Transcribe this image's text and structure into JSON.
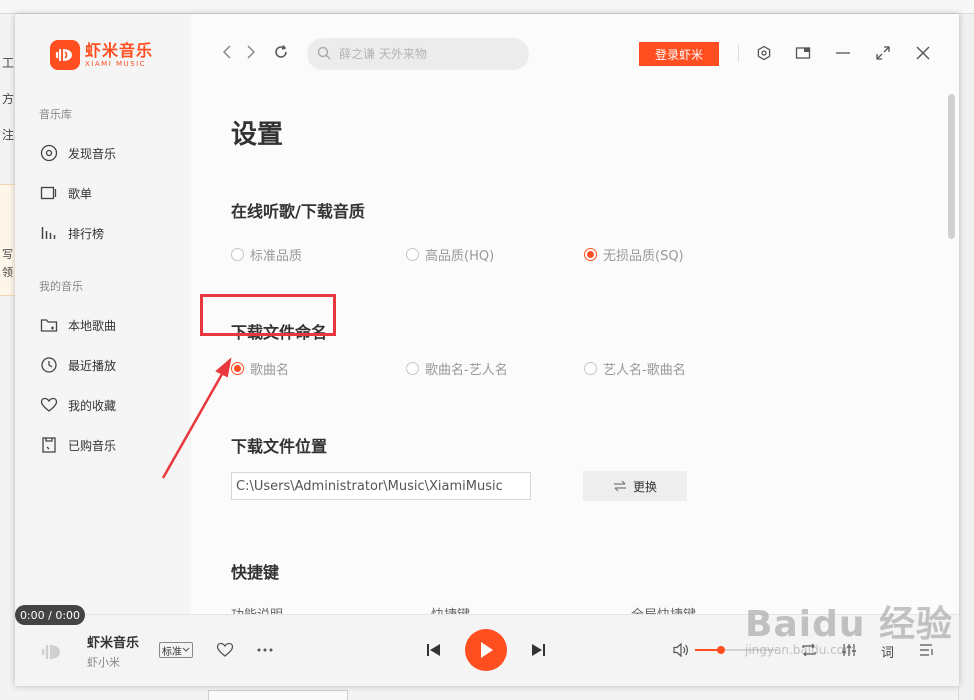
{
  "background": {
    "left_texts": [
      "工",
      "方",
      "注",
      "写",
      "领"
    ]
  },
  "app": {
    "logo_cn": "虾米音乐",
    "logo_en": "XIAMI MUSIC"
  },
  "sidebar": {
    "library_title": "音乐库",
    "library_items": [
      {
        "label": "发现音乐",
        "icon": "disc-icon"
      },
      {
        "label": "歌单",
        "icon": "playlist-icon"
      },
      {
        "label": "排行榜",
        "icon": "chart-icon"
      }
    ],
    "mine_title": "我的音乐",
    "mine_items": [
      {
        "label": "本地歌曲",
        "icon": "folder-icon"
      },
      {
        "label": "最近播放",
        "icon": "clock-icon"
      },
      {
        "label": "我的收藏",
        "icon": "heart-icon"
      },
      {
        "label": "已购音乐",
        "icon": "purchased-icon"
      }
    ]
  },
  "topbar": {
    "search_placeholder": "薛之谦 天外来物",
    "login_label": "登录虾米"
  },
  "settings": {
    "title": "设置",
    "quality": {
      "title": "在线听歌/下载音质",
      "options": [
        "标准品质",
        "高品质(HQ)",
        "无损品质(SQ)"
      ],
      "selected": 2
    },
    "naming": {
      "title": "下载文件命名",
      "options": [
        "歌曲名",
        "歌曲名-艺人名",
        "艺人名-歌曲名"
      ],
      "selected": 0
    },
    "location": {
      "title": "下载文件位置",
      "path": "C:\\Users\\Administrator\\Music\\XiamiMusic",
      "change_label": "更换"
    },
    "shortcuts": {
      "title": "快捷键",
      "columns": [
        "功能说明",
        "快捷键",
        "全局快捷键"
      ]
    }
  },
  "player": {
    "time": "0:00 / 0:00",
    "song_title": "虾米音乐",
    "artist": "虾小米",
    "quality": "标准",
    "lyric_label": "词",
    "volume": 0.32
  },
  "watermark": {
    "main": "Baidu 经验",
    "sub": "jingyan.baidu.com"
  },
  "colors": {
    "accent": "#ff4e20",
    "highlight": "#e8383d"
  }
}
